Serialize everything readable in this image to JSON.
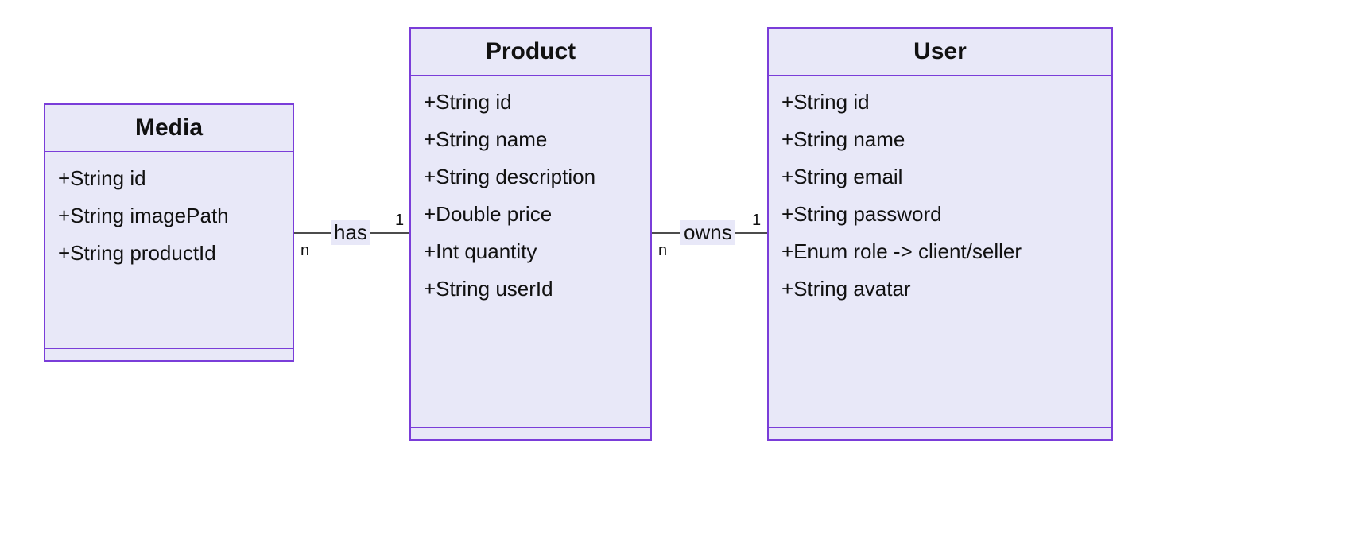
{
  "classes": {
    "media": {
      "name": "Media",
      "attrs": [
        "+String id",
        "+String imagePath",
        "+String productId"
      ]
    },
    "product": {
      "name": "Product",
      "attrs": [
        "+String id",
        "+String name",
        "+String description",
        "+Double price",
        "+Int quantity",
        "+String userId"
      ]
    },
    "user": {
      "name": "User",
      "attrs": [
        "+String id",
        "+String name",
        "+String email",
        "+String password",
        "+Enum role -> client/seller",
        "+String avatar"
      ]
    }
  },
  "relations": {
    "media_product": {
      "label": "has",
      "mult_left": "n",
      "mult_right": "1"
    },
    "product_user": {
      "label": "owns",
      "mult_left": "n",
      "mult_right": "1"
    }
  }
}
